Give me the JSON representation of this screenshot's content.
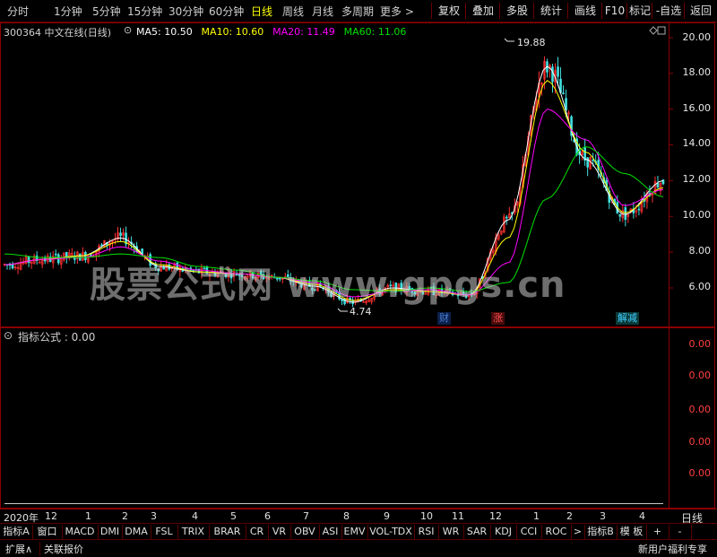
{
  "toolbar": {
    "periods": [
      "分时",
      "1分钟",
      "5分钟",
      "15分钟",
      "30分钟",
      "60分钟",
      "日线",
      "周线",
      "月线",
      "多周期",
      "更多 >"
    ],
    "active_period": "日线",
    "right_buttons": [
      "复权",
      "叠加",
      "多股",
      "统计",
      "画线",
      "F10",
      "标记",
      "-自选",
      "返回"
    ]
  },
  "stock": {
    "title": "300364 中文在线(日线)",
    "ma": [
      {
        "label": "MA5: 10.50",
        "color": "#ffffff"
      },
      {
        "label": "MA10: 10.60",
        "color": "#ffff00"
      },
      {
        "label": "MA20: 11.49",
        "color": "#ff00ff"
      },
      {
        "label": "MA60: 11.06",
        "color": "#00e000"
      }
    ],
    "high_label": "19.88",
    "low_label": "4.74"
  },
  "price_axis": [
    "20.00",
    "18.00",
    "16.00",
    "14.00",
    "12.00",
    "10.00",
    "8.00",
    "6.00"
  ],
  "events": [
    {
      "label": "财",
      "color": "#4a7fd4",
      "bg": "#0b1f4a"
    },
    {
      "label": "涨",
      "color": "#ff5050",
      "bg": "#4a0b0b"
    },
    {
      "label": "解减",
      "color": "#40d0ff",
      "bg": "#0b3a3a"
    }
  ],
  "indicator": {
    "title": "指标公式 : 0.00",
    "axis": [
      "0.00",
      "0.00",
      "0.00",
      "0.00",
      "0.00"
    ]
  },
  "time_axis": {
    "labels": [
      "2020年",
      "12",
      "1",
      "2",
      "3",
      "4",
      "5",
      "6",
      "7",
      "8",
      "9",
      "10",
      "11",
      "12",
      "1",
      "2",
      "3",
      "4"
    ],
    "right_label": "日线"
  },
  "tabs": [
    "指标A",
    "窗口",
    "MACD",
    "DMI",
    "DMA",
    "FSL",
    "TRIX",
    "BRAR",
    "CR",
    "VR",
    "OBV",
    "ASI",
    "EMV",
    "VOL-TDX",
    "RSI",
    "WR",
    "SAR",
    "KDJ",
    "CCI",
    "ROC",
    ">",
    "指标B",
    "模 板",
    "+",
    "-"
  ],
  "status": {
    "expand": "扩展∧",
    "related": "关联报价",
    "promo": "新用户福利专享"
  },
  "watermark": "股票公式网 www.gpgs.cn",
  "chart_data": {
    "type": "line",
    "title": "300364 中文在线(日线)",
    "ylim": [
      4,
      21
    ],
    "x": [
      "2019-11",
      "2019-12",
      "2020-01",
      "2020-02",
      "2020-03",
      "2020-04",
      "2020-05",
      "2020-06",
      "2020-07",
      "2020-08",
      "2020-09",
      "2020-10",
      "2020-11",
      "2020-12",
      "2021-01",
      "2021-02",
      "2021-03",
      "2021-04"
    ],
    "series": [
      {
        "name": "MA5",
        "values": [
          7.3,
          7.6,
          7.8,
          8.8,
          7.2,
          6.9,
          6.8,
          6.6,
          6.1,
          5.2,
          6.0,
          5.8,
          5.6,
          9.8,
          18.4,
          13.2,
          10.1,
          12.0
        ]
      },
      {
        "name": "MA10",
        "values": [
          7.3,
          7.6,
          7.8,
          8.6,
          7.3,
          6.9,
          6.8,
          6.6,
          6.2,
          5.3,
          5.9,
          5.8,
          5.6,
          8.8,
          17.6,
          13.6,
          10.2,
          11.6
        ]
      },
      {
        "name": "MA20",
        "values": [
          7.3,
          7.6,
          7.7,
          8.3,
          7.5,
          7.0,
          6.8,
          6.6,
          6.3,
          5.5,
          5.8,
          5.9,
          5.6,
          7.4,
          16.0,
          14.3,
          10.6,
          11.5
        ]
      },
      {
        "name": "MA60",
        "values": [
          7.9,
          7.7,
          7.7,
          7.9,
          7.7,
          7.2,
          7.0,
          6.6,
          6.4,
          5.9,
          5.8,
          6.0,
          5.8,
          6.3,
          11.0,
          13.9,
          12.4,
          11.1
        ]
      }
    ]
  }
}
